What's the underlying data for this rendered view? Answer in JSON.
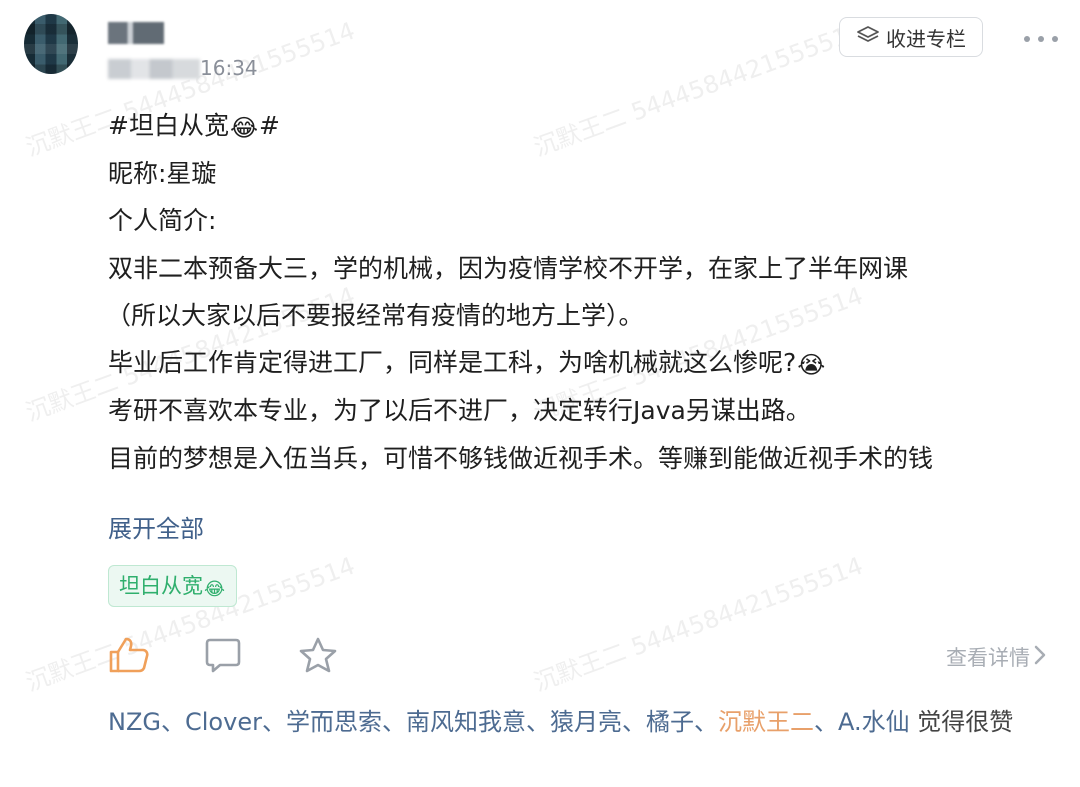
{
  "post": {
    "time": "16:34",
    "collect_label": "收进专栏",
    "lines": [
      {
        "text": "#坦白从宽",
        "emoji": "😂",
        "after": "#"
      },
      {
        "text": "昵称:星璇"
      },
      {
        "text": "个人简介:"
      },
      {
        "text": "双非二本预备大三，学的机械，因为疫情学校不开学，在家上了半年网课"
      },
      {
        "text": "（所以大家以后不要报经常有疫情的地方上学）。"
      },
      {
        "text": "毕业后工作肯定得进工厂，同样是工科，为啥机械就这么惨呢?",
        "emoji": "😭"
      },
      {
        "text": "考研不喜欢本专业，为了以后不进厂，决定转行Java另谋出路。"
      },
      {
        "text": "目前的梦想是入伍当兵，可惜不够钱做近视手术。等赚到能做近视手术的钱"
      }
    ],
    "expand_label": "展开全部",
    "topic_tag": "坦白从宽",
    "topic_emoji": "😂",
    "detail_label": "查看详情",
    "likers": [
      "NZG",
      "Clover",
      "学而思索",
      "南风知我意",
      "猿月亮",
      "橘子"
    ],
    "likers_me": "沉默王二",
    "likers_last": "A.水仙",
    "likers_tail": "觉得很赞"
  },
  "watermark": "沉默王二 5444584421555514",
  "colors": {
    "link": "#40608a",
    "tag_green": "#2faf6d",
    "like_orange": "#f0a05a",
    "muted": "#a8adb4"
  },
  "icons": [
    "stack-icon",
    "more-icon",
    "like-icon",
    "comment-icon",
    "star-icon",
    "chevron-right-icon"
  ]
}
